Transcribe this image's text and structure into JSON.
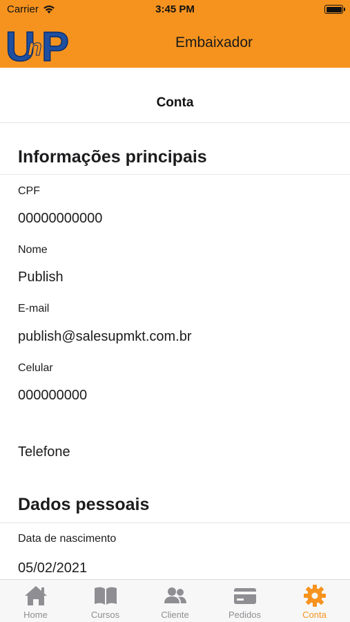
{
  "status_bar": {
    "carrier": "Carrier",
    "time": "3:45 PM"
  },
  "header": {
    "logo_text": "UnP",
    "title": "Embaixador",
    "accent_color": "#f6931f"
  },
  "subheader": {
    "title": "Conta"
  },
  "sections": {
    "main": {
      "title": "Informações principais",
      "fields": {
        "cpf": {
          "label": "CPF",
          "value": "00000000000"
        },
        "nome": {
          "label": "Nome",
          "value": "Publish"
        },
        "email": {
          "label": "E-mail",
          "value": "publish@salesupmkt.com.br"
        },
        "celular": {
          "label": "Celular",
          "value": "000000000"
        },
        "telefone": {
          "label": "Telefone"
        }
      }
    },
    "personal": {
      "title": "Dados pessoais",
      "fields": {
        "nascimento": {
          "label": "Data de nascimento",
          "value": "05/02/2021"
        }
      }
    }
  },
  "tabbar": {
    "active": "Conta",
    "active_color": "#f6931f",
    "inactive_color": "#8e8e93",
    "items": [
      {
        "label": "Home",
        "icon": "home-icon"
      },
      {
        "label": "Cursos",
        "icon": "book-icon"
      },
      {
        "label": "Cliente",
        "icon": "people-icon"
      },
      {
        "label": "Pedidos",
        "icon": "card-icon"
      },
      {
        "label": "Conta",
        "icon": "gear-icon"
      }
    ]
  }
}
